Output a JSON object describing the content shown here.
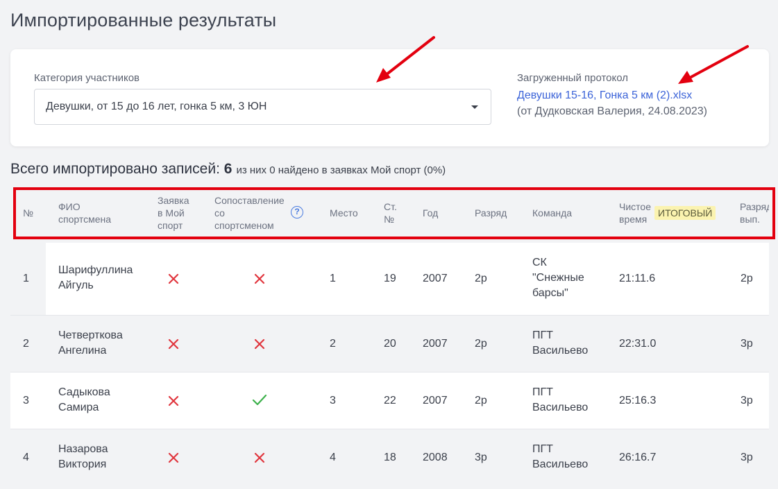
{
  "page": {
    "title": "Импортированные результаты"
  },
  "filters": {
    "category_label": "Категория участников",
    "category_value": "Девушки, от 15 до 16 лет, гонка 5 км, 3 ЮН",
    "protocol_label": "Загруженный протокол",
    "protocol_file": "Девушки 15-16, Гонка 5 км (2).xlsx",
    "protocol_meta": "(от Дудковская Валерия, 24.08.2023)"
  },
  "summary": {
    "label": "Всего импортировано записей:",
    "count": "6",
    "detail": "из них 0 найдено в заявках Мой спорт (0%)"
  },
  "table": {
    "headers": {
      "num": "№",
      "fio_1": "ФИО",
      "fio_2": "спортсмена",
      "app_1": "Заявка",
      "app_2": "в Мой",
      "app_3": "спорт",
      "match_1": "Сопоставление",
      "match_2": "со",
      "match_3": "спортсменом",
      "help": "?",
      "place": "Место",
      "start_1": "Ст.",
      "start_2": "№",
      "year": "Год",
      "rank": "Разряд",
      "team": "Команда",
      "time_1": "Чистое",
      "time_2": "время",
      "final_badge": "ИТОГОВЫЙ",
      "rank_done_1": "Разряд",
      "rank_done_2": "вып."
    },
    "rows": [
      {
        "num": "1",
        "fio_1": "Шарифуллина",
        "fio_2": "Айгуль",
        "app": "cross",
        "match": "cross",
        "place": "1",
        "start": "19",
        "year": "2007",
        "rank": "2р",
        "team_1": "СК",
        "team_2": "\"Снежные",
        "team_3": "барсы\"",
        "time": "21:11.6",
        "rank_done": "2р"
      },
      {
        "num": "2",
        "fio_1": "Четверткова",
        "fio_2": "Ангелина",
        "app": "cross",
        "match": "cross",
        "place": "2",
        "start": "20",
        "year": "2007",
        "rank": "2р",
        "team_1": "ПГТ",
        "team_2": "Васильево",
        "team_3": "",
        "time": "22:31.0",
        "rank_done": "3р"
      },
      {
        "num": "3",
        "fio_1": "Садыкова",
        "fio_2": "Самира",
        "app": "cross",
        "match": "check",
        "place": "3",
        "start": "22",
        "year": "2007",
        "rank": "2р",
        "team_1": "ПГТ",
        "team_2": "Васильево",
        "team_3": "",
        "time": "25:16.3",
        "rank_done": "3р"
      },
      {
        "num": "4",
        "fio_1": "Назарова",
        "fio_2": "Виктория",
        "app": "cross",
        "match": "cross",
        "place": "4",
        "start": "18",
        "year": "2008",
        "rank": "3р",
        "team_1": "ПГТ",
        "team_2": "Васильево",
        "team_3": "",
        "time": "26:16.7",
        "rank_done": "3р"
      }
    ]
  },
  "colors": {
    "accent_link": "#3b63d8",
    "cross": "#e0353d",
    "check": "#3bb04a",
    "highlight_box": "#e3000f",
    "badge_bg": "#fbf3b0"
  }
}
